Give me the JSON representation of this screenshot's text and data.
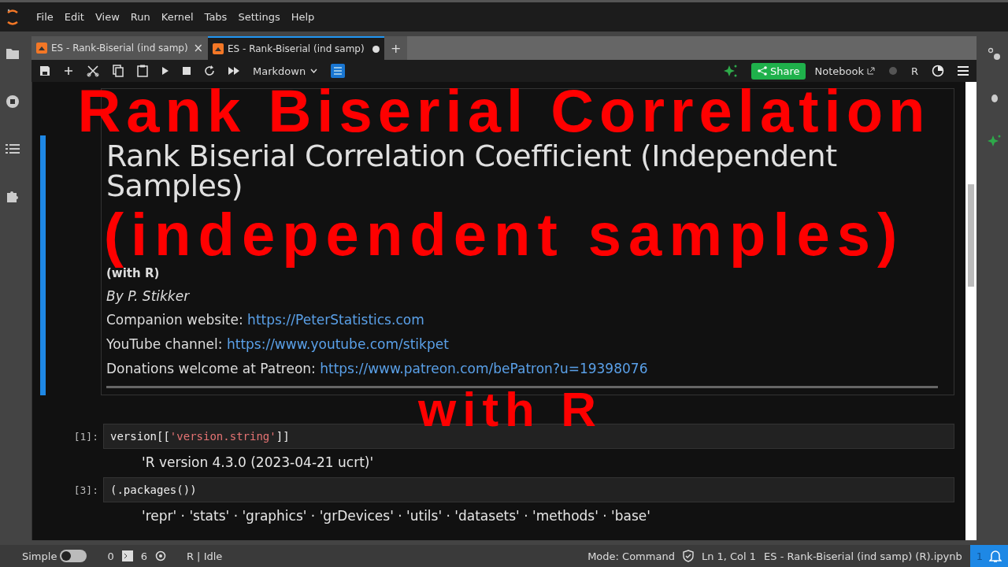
{
  "menu": [
    "File",
    "Edit",
    "View",
    "Run",
    "Kernel",
    "Tabs",
    "Settings",
    "Help"
  ],
  "tabs": [
    {
      "label": "ES - Rank-Biserial (ind samp)",
      "selected": false,
      "modified": false,
      "close": "×"
    },
    {
      "label": "ES - Rank-Biserial (ind samp)",
      "selected": true,
      "modified": true
    }
  ],
  "new_tab": "+",
  "toolbar": {
    "cell_type": "Markdown",
    "share": "Share",
    "notebook": "Notebook",
    "kernel": "R"
  },
  "markdown_cell": {
    "title": "Rank Biserial Correlation Coefficient (Independent Samples)",
    "subtitle": "(with R)",
    "author": "By P. Stikker",
    "links": [
      {
        "label": "Companion website:",
        "url": "https://PeterStatistics.com"
      },
      {
        "label": "YouTube channel:",
        "url": "https://www.youtube.com/stikpet"
      },
      {
        "label": "Donations welcome at Patreon:",
        "url": "https://www.patreon.com/bePatron?u=19398076"
      }
    ]
  },
  "cells": [
    {
      "prompt": "[1]:",
      "code_parts": [
        {
          "kind": "plain",
          "text": "version[["
        },
        {
          "kind": "string",
          "text": "'version.string'"
        },
        {
          "kind": "plain",
          "text": "]]"
        }
      ],
      "output": "'R version 4.3.0 (2023-04-21 ucrt)'"
    },
    {
      "prompt": "[3]:",
      "code_parts": [
        {
          "kind": "plain",
          "text": "(.packages())"
        }
      ],
      "output": "'repr' · 'stats' · 'graphics' · 'grDevices' · 'utils' · 'datasets' · 'methods' · 'base'"
    }
  ],
  "status_bar": {
    "mode_label": "Simple",
    "simple_on": false,
    "terminals": "0",
    "kernels": "6",
    "kernel_status": "R | Idle",
    "mode": "Mode: Command",
    "position": "Ln 1, Col 1",
    "file": "ES - Rank-Biserial (ind samp) (R).ipynb",
    "notifications": "1"
  },
  "caption": [
    "Rank Biserial Correlation",
    "(independent samples)",
    "with R"
  ]
}
